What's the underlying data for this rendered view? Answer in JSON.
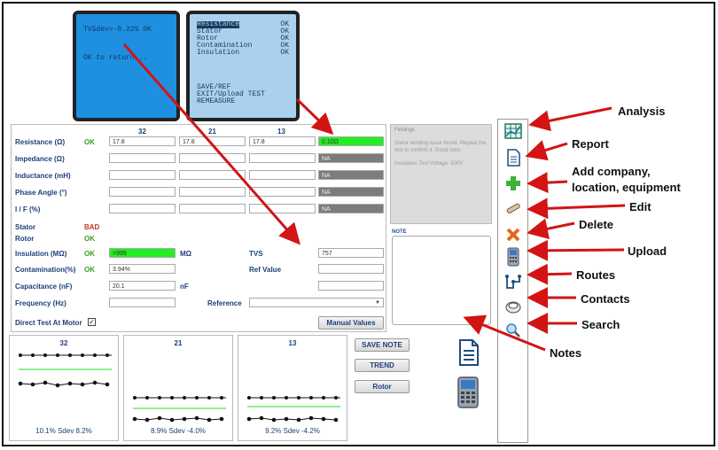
{
  "screen1": {
    "line1": "TVSdev=-0.22%  OK",
    "line2": "OK to return..."
  },
  "screen2": {
    "items": [
      {
        "label": "Resistance",
        "status": "OK"
      },
      {
        "label": "Stator",
        "status": "OK"
      },
      {
        "label": "Rotor",
        "status": "OK"
      },
      {
        "label": "Contamination",
        "status": "OK"
      },
      {
        "label": "Insulation",
        "status": "OK"
      }
    ],
    "menu": [
      "SAVE/REF",
      "EXIT/Upload TEST",
      "REMEASURE"
    ]
  },
  "form": {
    "columns": [
      "32",
      "21",
      "13"
    ],
    "rows": {
      "resistance": {
        "label": "Resistance (Ω)",
        "status": "OK",
        "v1": "17.8",
        "v2": "17.8",
        "v3": "17.8",
        "result": "0.10Ω"
      },
      "impedance": {
        "label": "Impedance (Ω)",
        "result": "NA"
      },
      "inductance": {
        "label": "Inductance (mH)",
        "result": "NA"
      },
      "phase": {
        "label": "Phase Angle (°)",
        "result": "NA"
      },
      "if": {
        "label": "I / F (%)",
        "result": "NA"
      },
      "stator": {
        "label": "Stator",
        "status": "BAD"
      },
      "rotor": {
        "label": "Rotor",
        "status": "OK"
      },
      "insulation": {
        "label": "Insulation (MΩ)",
        "status": "OK",
        "value": ">999",
        "unit": "MΩ"
      },
      "contamination": {
        "label": "Contamination(%)",
        "status": "OK",
        "value": "3.94%"
      },
      "capacitance": {
        "label": "Capacitance (nF)",
        "value": "20.1",
        "unit": "nF"
      },
      "frequency": {
        "label": "Frequency (Hz)"
      }
    },
    "tvs_label": "TVS",
    "tvs_value": "757",
    "ref_value_label": "Ref Value",
    "reference_label": "Reference",
    "direct_test_label": "Direct Test At Motor",
    "manual_values_label": "Manual Values"
  },
  "findings": {
    "title": "Findings",
    "text1": "Stator winding issue found. Repeat the test to confirm it. Good rotor.",
    "text2": "Insulation Test Voltage: 500V"
  },
  "note_label": "NOTE",
  "buttons": {
    "save_note": "SAVE NOTE",
    "trend": "TREND",
    "rotor": "Rotor"
  },
  "graphs": [
    {
      "title": "32",
      "stats": "10.1%   Sdev 8.2%"
    },
    {
      "title": "21",
      "stats": "8.9%   Sdev -4.0%"
    },
    {
      "title": "13",
      "stats": "9.2%   Sdev -4.2%"
    }
  ],
  "annotations": {
    "analysis": "Analysis",
    "report": "Report",
    "add": "Add company,",
    "add2": "location, equipment",
    "edit": "Edit",
    "delete": "Delete",
    "upload": "Upload",
    "routes": "Routes",
    "contacts": "Contacts",
    "search": "Search",
    "notes": "Notes"
  },
  "icons": [
    "analysis-icon",
    "report-icon",
    "add-icon",
    "edit-icon",
    "delete-icon",
    "upload-icon",
    "routes-icon",
    "contacts-icon",
    "search-icon"
  ],
  "colors": {
    "accent": "#1d3f78",
    "ok": "#3a9e1e",
    "bad": "#c0392b",
    "arrow": "#d21414",
    "highlight": "#22ee22"
  }
}
